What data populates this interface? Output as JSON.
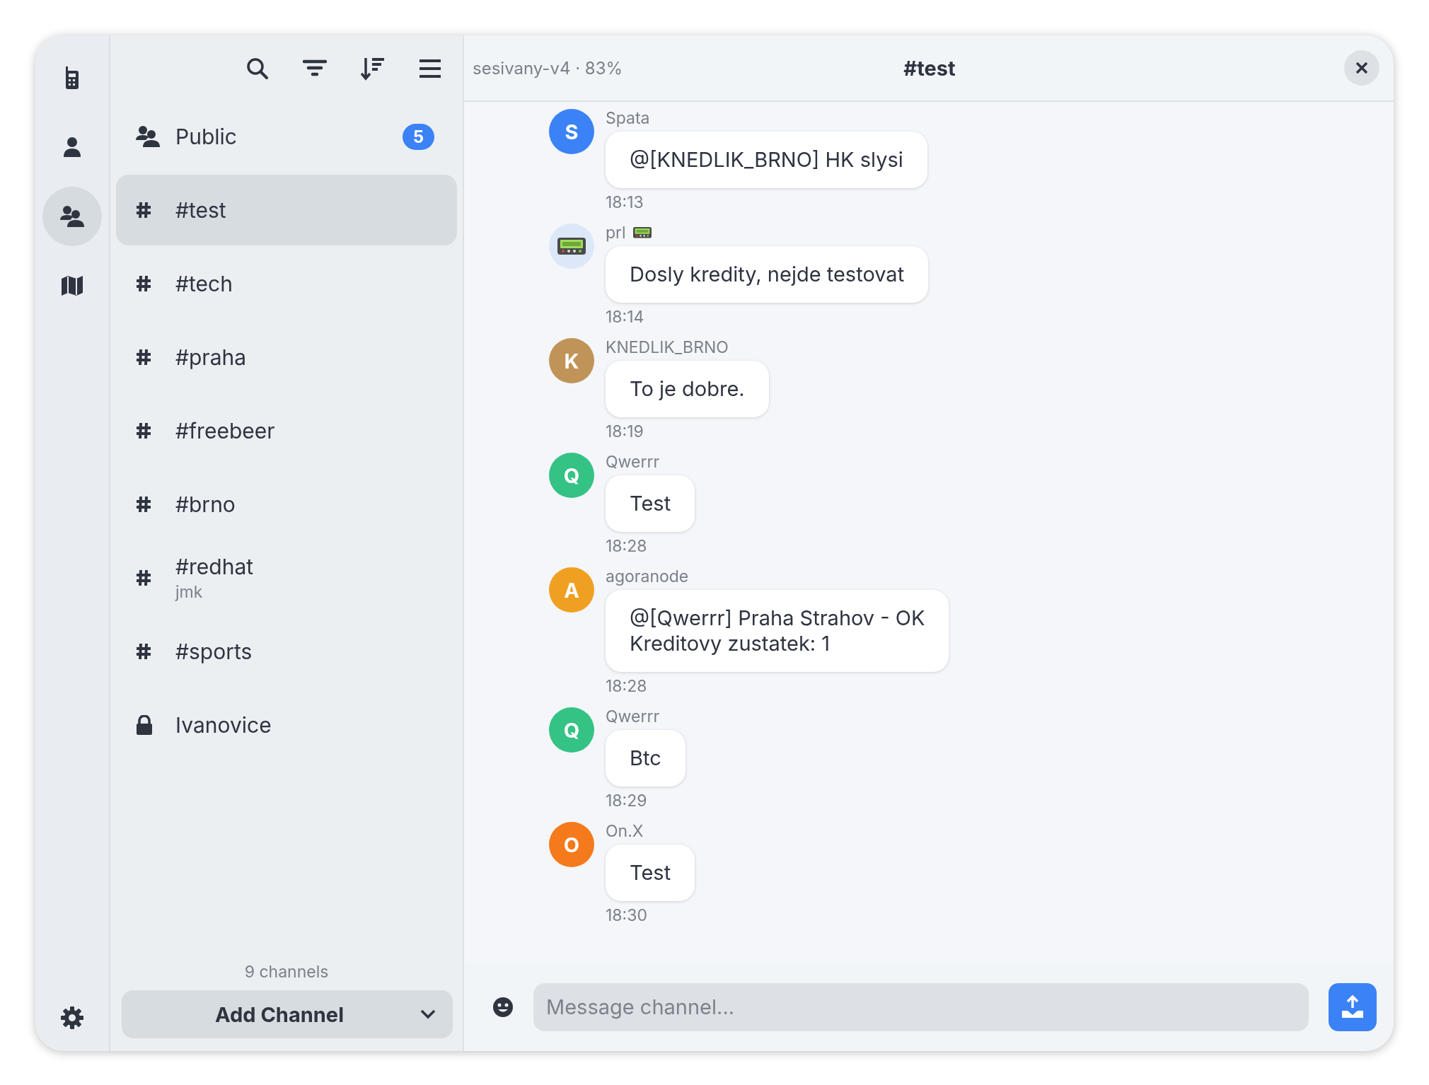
{
  "rail": {
    "items": [
      {
        "kind": "phone",
        "selected": false
      },
      {
        "kind": "person",
        "selected": false
      },
      {
        "kind": "people",
        "selected": true
      },
      {
        "kind": "map",
        "selected": false
      }
    ]
  },
  "sidebar": {
    "channels": [
      {
        "kind": "group",
        "name": "Public",
        "badge": "5",
        "selected": false
      },
      {
        "kind": "hash",
        "name": "#test",
        "selected": true
      },
      {
        "kind": "hash",
        "name": "#tech",
        "selected": false
      },
      {
        "kind": "hash",
        "name": "#praha",
        "selected": false
      },
      {
        "kind": "hash",
        "name": "#freebeer",
        "selected": false
      },
      {
        "kind": "hash",
        "name": "#brno",
        "selected": false
      },
      {
        "kind": "hash",
        "name": "#redhat",
        "subtitle": "jmk",
        "selected": false
      },
      {
        "kind": "hash",
        "name": "#sports",
        "selected": false
      },
      {
        "kind": "lock",
        "name": "Ivanovice",
        "selected": false
      }
    ],
    "count": "9 channels",
    "add_button": "Add Channel"
  },
  "header": {
    "subtitle": "sesivany-v4 · 83%",
    "title": "#test"
  },
  "messages": [
    {
      "sender": "Spata",
      "kind": "letter",
      "avatar": "S",
      "color": "#3b82f6",
      "text": "@[KNEDLIK_BRNO] HK slysi",
      "time": "18:13"
    },
    {
      "sender": "prl",
      "kind": "pager",
      "text": "Dosly kredity, nejde testovat",
      "time": "18:14"
    },
    {
      "sender": "KNEDLIK_BRNO",
      "kind": "letter",
      "avatar": "K",
      "color": "#c09458",
      "text": "To je dobre.",
      "time": "18:19"
    },
    {
      "sender": "Qwerrr",
      "kind": "letter",
      "avatar": "Q",
      "color": "#34c384",
      "text": "Test",
      "time": "18:28"
    },
    {
      "sender": "agoranode",
      "kind": "letter",
      "avatar": "A",
      "color": "#f0a020",
      "text": "@[Qwerrr] Praha Strahov - OK\nKreditovy zustatek: 1",
      "time": "18:28"
    },
    {
      "sender": "Qwerrr",
      "kind": "letter",
      "avatar": "Q",
      "color": "#34c384",
      "text": "Btc",
      "time": "18:29"
    },
    {
      "sender": "On.X",
      "kind": "letter",
      "avatar": "O",
      "color": "#f47a1c",
      "text": "Test",
      "time": "18:30"
    }
  ],
  "composer": {
    "placeholder": "Message channel..."
  }
}
